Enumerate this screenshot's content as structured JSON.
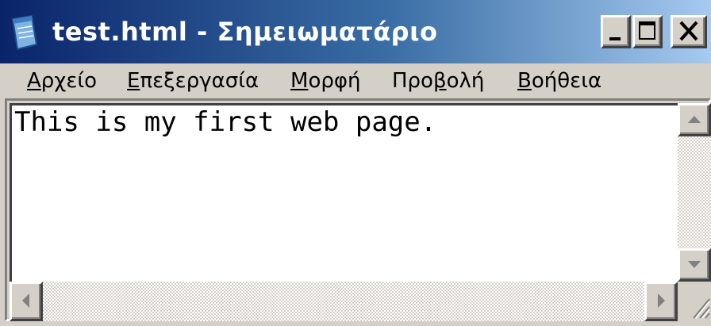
{
  "window": {
    "title": "test.html - Σημειωματάριο",
    "controls": {
      "minimize_icon": "minimize-icon",
      "maximize_icon": "maximize-icon",
      "close_icon": "close-icon"
    }
  },
  "menu": {
    "items": [
      {
        "accel": "Α",
        "rest": "ρχείο"
      },
      {
        "accel": "Ε",
        "rest": "πεξεργασία"
      },
      {
        "accel": "Μ",
        "rest": "ορφή"
      },
      {
        "pre": "Προ",
        "accel": "β",
        "rest": "ολή"
      },
      {
        "accel": "Β",
        "rest": "οήθεια"
      }
    ]
  },
  "editor": {
    "content": "This is my first web page."
  },
  "colors": {
    "title_start": "#0a246a",
    "title_end": "#a6caf0",
    "chrome": "#d4d0c8"
  }
}
